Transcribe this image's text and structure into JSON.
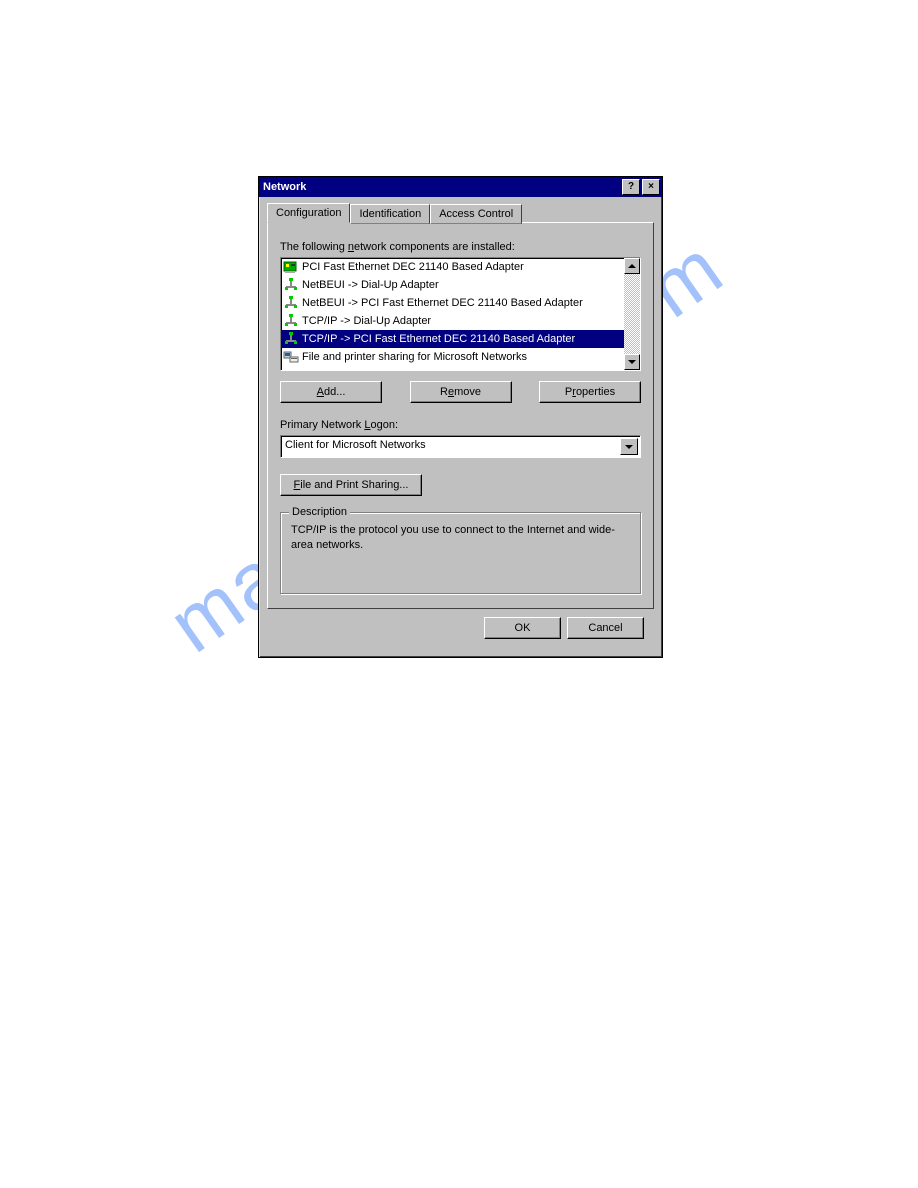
{
  "watermark": "manualshive.com",
  "dialog": {
    "title": "Network",
    "help_button": "?",
    "close_button": "×",
    "tabs": [
      "Configuration",
      "Identification",
      "Access Control"
    ],
    "active_tab": 0,
    "components_label_pre": "The following ",
    "components_label_underline": "n",
    "components_label_post": "etwork components are installed:",
    "components": [
      {
        "icon": "nic",
        "text": "PCI Fast Ethernet DEC 21140 Based Adapter",
        "selected": false
      },
      {
        "icon": "proto",
        "text": "NetBEUI -> Dial-Up Adapter",
        "selected": false
      },
      {
        "icon": "proto",
        "text": "NetBEUI -> PCI Fast Ethernet DEC 21140 Based Adapter",
        "selected": false
      },
      {
        "icon": "proto",
        "text": "TCP/IP -> Dial-Up Adapter",
        "selected": false
      },
      {
        "icon": "proto",
        "text": "TCP/IP -> PCI Fast Ethernet DEC 21140 Based Adapter",
        "selected": true
      },
      {
        "icon": "svc",
        "text": "File and printer sharing for Microsoft Networks",
        "selected": false
      }
    ],
    "buttons": {
      "add_u": "A",
      "add_rest": "dd...",
      "remove_pre": "R",
      "remove_u": "e",
      "remove_post": "move",
      "properties_pre": "P",
      "properties_u": "r",
      "properties_post": "operties"
    },
    "logon_label_pre": "Primary Network ",
    "logon_label_u": "L",
    "logon_label_post": "ogon:",
    "logon_value": "Client for Microsoft Networks",
    "fps_button_u": "F",
    "fps_button_rest": "ile and Print Sharing...",
    "description_title": "Description",
    "description_text": "TCP/IP is the protocol you use to connect to the Internet and wide-area networks.",
    "ok": "OK",
    "cancel": "Cancel"
  }
}
